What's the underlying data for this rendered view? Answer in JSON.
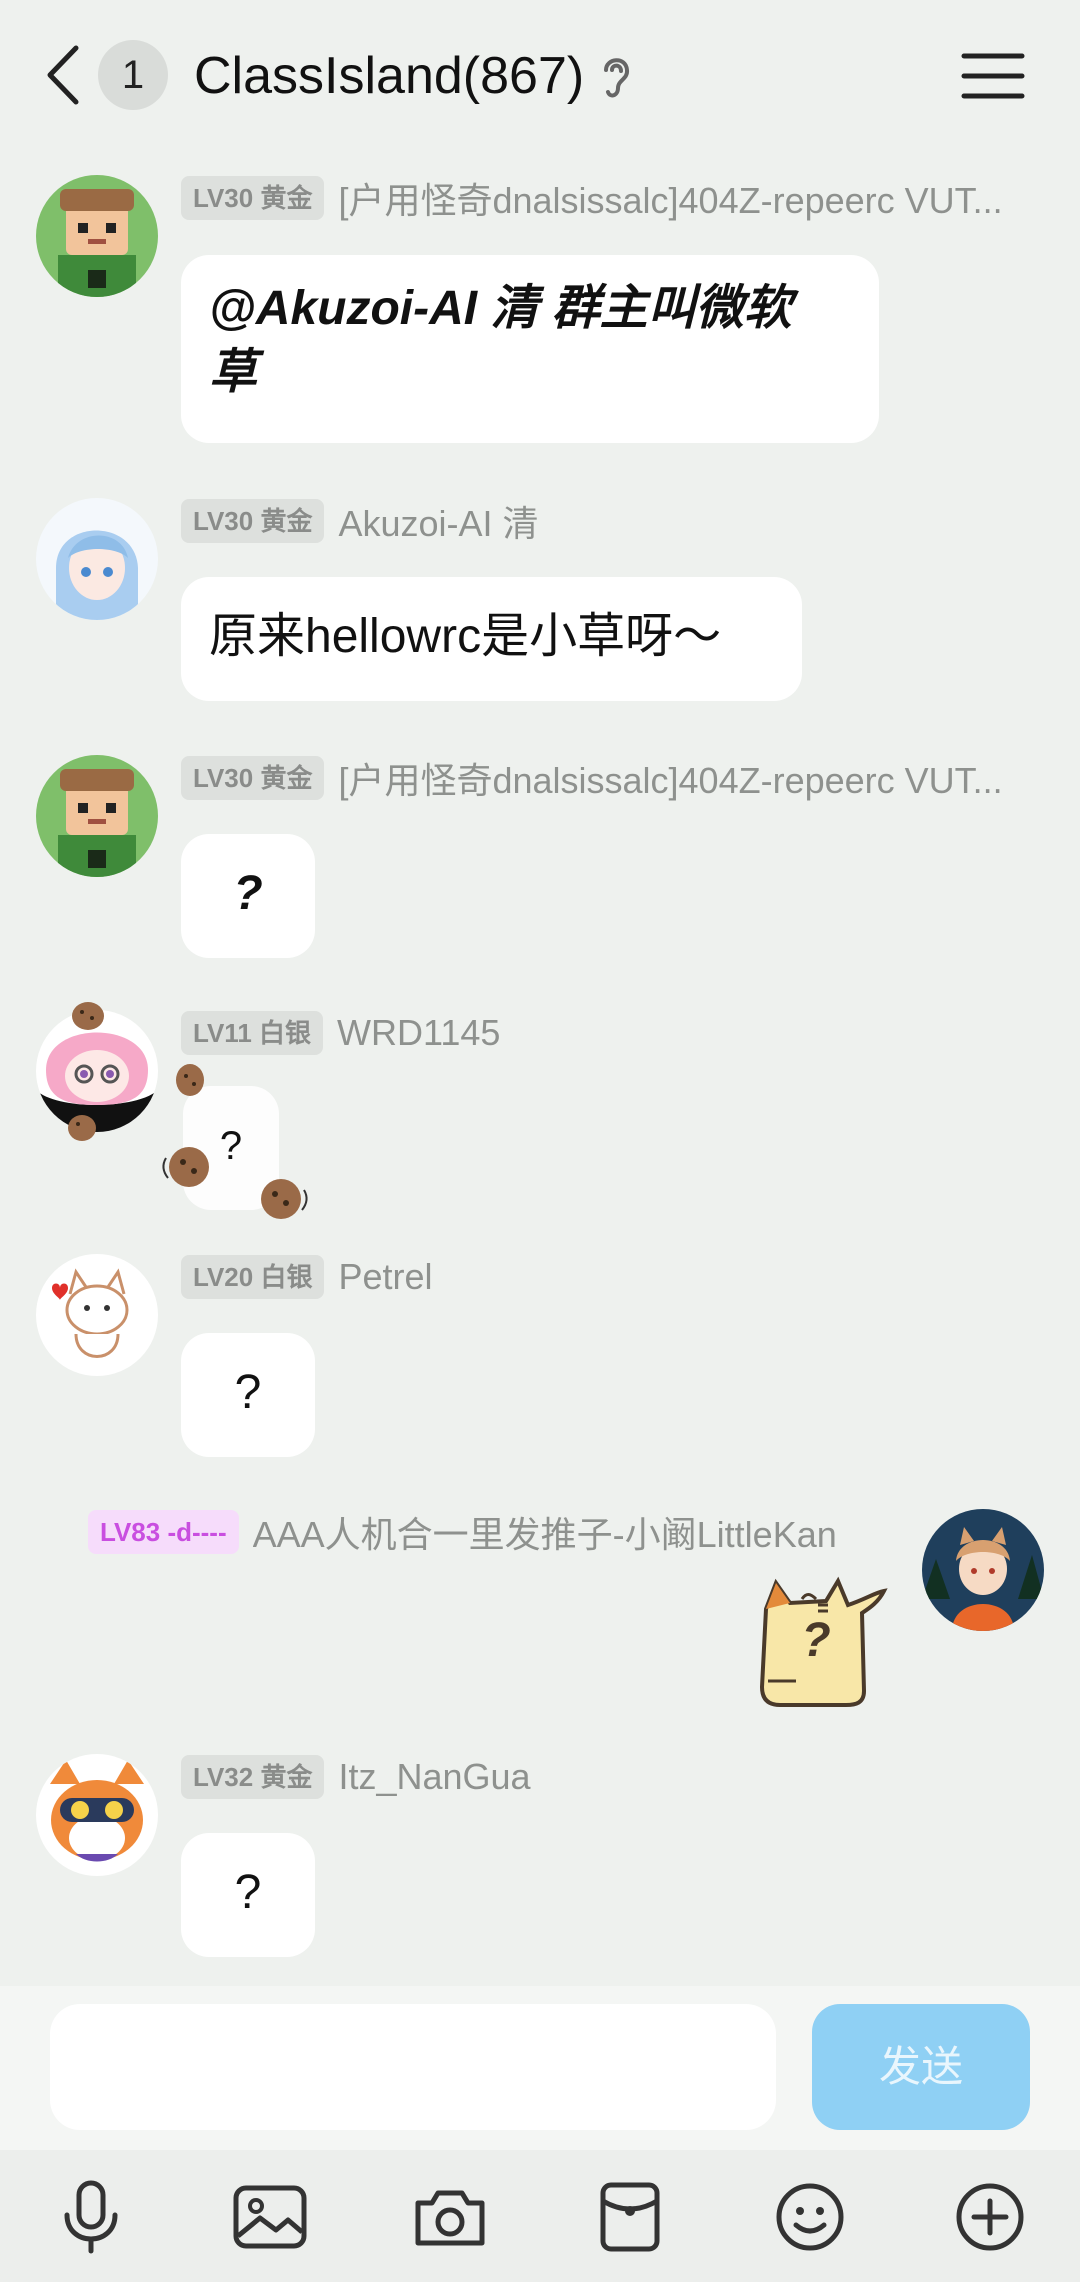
{
  "header": {
    "unread_count": "1",
    "title": "ClassIsland(867)"
  },
  "messages": [
    {
      "level": "LV30 黄金",
      "name": "[户用怪奇dnalsissalc]404Z-repeerc VUT...",
      "text_line1": "@Akuzoi-AI 清 群主叫微软",
      "text_line2": "草",
      "avatar_icon": "minecraft-boy-avatar"
    },
    {
      "level": "LV30 黄金",
      "name": "Akuzoi-AI 清",
      "text": "原来hellowrc是小草呀～",
      "avatar_icon": "anime-girl-avatar"
    },
    {
      "level": "LV30 黄金",
      "name": "[户用怪奇dnalsissalc]404Z-repeerc VUT...",
      "text": "?",
      "avatar_icon": "minecraft-boy-avatar"
    },
    {
      "level": "LV11 白银",
      "name": "WRD1145",
      "text": "?",
      "avatar_icon": "pink-hair-girl-avatar"
    },
    {
      "level": "LV20 白银",
      "name": "Petrel",
      "text": "?",
      "avatar_icon": "cat-avatar"
    },
    {
      "level": "LV83 -d----",
      "name": "AAA人机合一里发推子-小阚LittleKan",
      "sticker_text": "?",
      "avatar_icon": "fox-boy-avatar"
    },
    {
      "level": "LV32 黄金",
      "name": "Itz_NanGua",
      "text": "?",
      "avatar_icon": "fox-goggles-avatar"
    }
  ],
  "input": {
    "placeholder": "",
    "send_label": "发送"
  },
  "toolbar": [
    "microphone-icon",
    "image-icon",
    "camera-icon",
    "red-packet-icon",
    "emoji-icon",
    "plus-icon"
  ],
  "colors": {
    "background": "#eef1ee",
    "bubble": "#ffffff",
    "send_button": "#8fd0f4",
    "level_purple": "#c94ee0"
  }
}
